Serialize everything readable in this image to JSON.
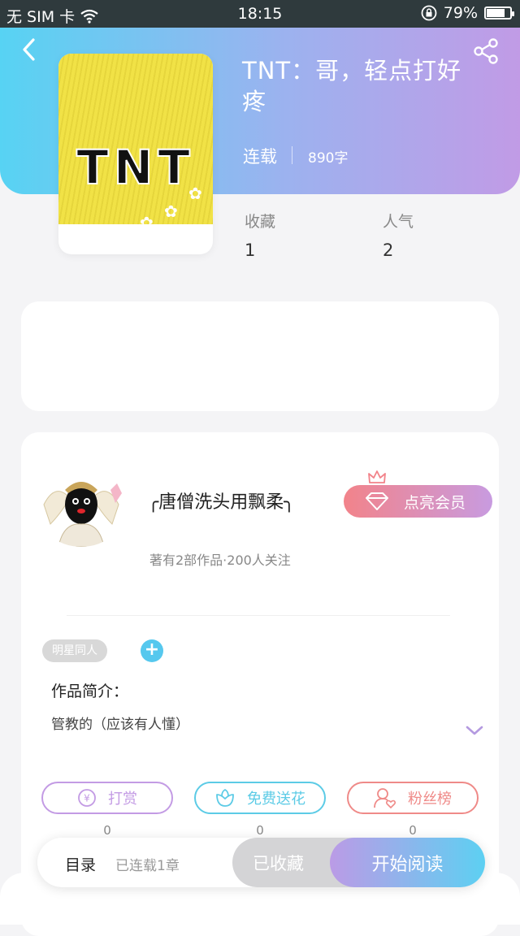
{
  "status_bar": {
    "carrier": "无 SIM 卡",
    "time": "18:15",
    "battery": "79%",
    "battery_level": 0.79
  },
  "book": {
    "title": "TNT：哥，轻点打好疼",
    "cover_text": "TNT",
    "status": "连载",
    "words": "890字",
    "stats": [
      {
        "label": "收藏",
        "value": "1"
      },
      {
        "label": "人气",
        "value": "2"
      }
    ]
  },
  "author": {
    "name": "╭唐僧洗头用飘柔╮",
    "meta": "著有2部作品·200人关注",
    "vip_button": "点亮会员"
  },
  "tags": [
    "明星同人"
  ],
  "tag_add": "+",
  "intro": {
    "label": "作品简介：",
    "text": "管教的（应该有人懂）"
  },
  "actions": [
    {
      "label": "打赏",
      "icon": "yen-icon",
      "count": "0",
      "color": "#c39be4"
    },
    {
      "label": "免费送花",
      "icon": "flower-icon",
      "count": "0",
      "color": "#5ccbe6"
    },
    {
      "label": "粉丝榜",
      "icon": "fans-icon",
      "count": "0",
      "color": "#ef8a88"
    }
  ],
  "bottom": {
    "toc": "目录",
    "toc_sub": "已连载1章",
    "collected": "已收藏",
    "read": "开始阅读"
  },
  "colors": {
    "header_start": "#57d3f3",
    "header_end": "#c19be6",
    "accent_blue": "#56c8ee",
    "vip_pink": "#f2838a"
  }
}
